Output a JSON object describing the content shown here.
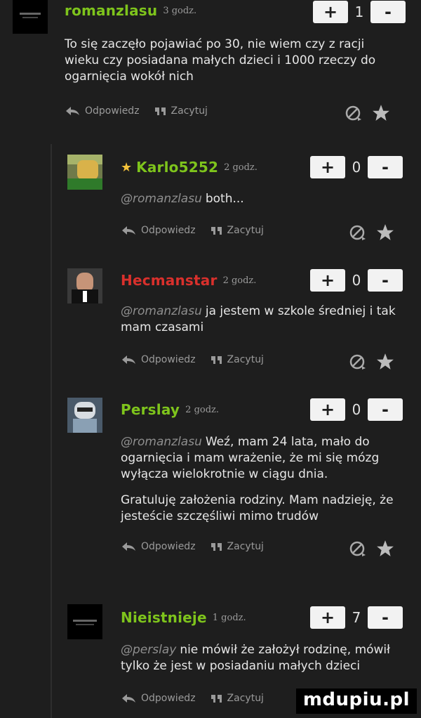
{
  "labels": {
    "reply": "Odpowiedz",
    "quote": "Zacytuj",
    "plus": "+",
    "minus": "-"
  },
  "colors": {
    "green_nick": "#7ec41c",
    "red_nick": "#d9302c",
    "timestamp": "#9a9a9a",
    "background": "#1e1e1e"
  },
  "icons": [
    "reply-arrow-icon",
    "quote-icon",
    "block-icon",
    "favorite-star-icon",
    "gold-star-badge-icon"
  ],
  "comments": [
    {
      "author": "romanzlasu",
      "time": "3 godz.",
      "votes": "1",
      "mention": "",
      "text": "To się zaczęło pojawiać po 30, nie wiem czy z racji wieku czy posiadana małych dzieci i 1000 rzeczy do ogarnięcia wokół nich",
      "text2": ""
    },
    {
      "author": "Karlo5252",
      "time": "2 godz.",
      "votes": "0",
      "mention": "@romanzlasu",
      "text": "both...",
      "text2": ""
    },
    {
      "author": "Hecmanstar",
      "time": "2 godz.",
      "votes": "0",
      "mention": "@romanzlasu",
      "text": "ja jestem w szkole średniej i tak mam czasami",
      "text2": ""
    },
    {
      "author": "Perslay",
      "time": "2 godz.",
      "votes": "0",
      "mention": "@romanzlasu",
      "text": "Weź, mam 24 lata, mało do ogarnięcia i mam wrażenie, że mi się mózg wyłącza wielokrotnie w ciągu dnia.",
      "text2": "Gratuluję założenia rodziny. Mam nadzieję, że jesteście szczęśliwi mimo trudów"
    },
    {
      "author": "Nieistnieje",
      "time": "1 godz.",
      "votes": "7",
      "mention": "@perslay",
      "text": "nie mówił że założył rodzinę, mówił tylko że jest w posiadaniu małych dzieci",
      "text2": ""
    }
  ],
  "watermark": "mdupiu.pl"
}
